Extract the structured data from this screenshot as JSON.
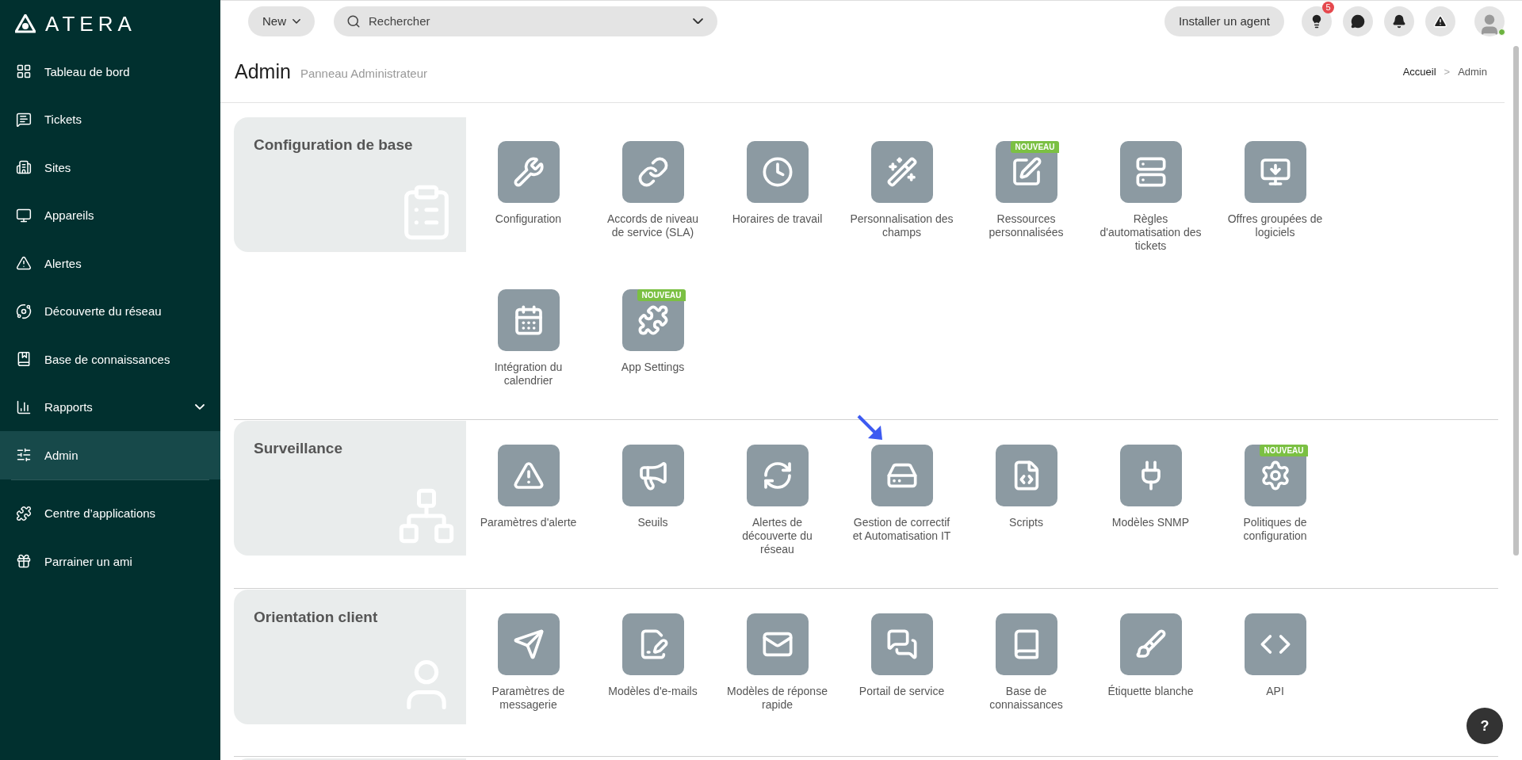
{
  "sidebar": {
    "logo": "ATERA",
    "items": [
      {
        "label": "Tableau de bord",
        "selected": false,
        "expandable": false
      },
      {
        "label": "Tickets",
        "selected": false,
        "expandable": false
      },
      {
        "label": "Sites",
        "selected": false,
        "expandable": false
      },
      {
        "label": "Appareils",
        "selected": false,
        "expandable": false
      },
      {
        "label": "Alertes",
        "selected": false,
        "expandable": false
      },
      {
        "label": "Découverte du réseau",
        "selected": false,
        "expandable": false
      },
      {
        "label": "Base de connaissances",
        "selected": false,
        "expandable": false
      },
      {
        "label": "Rapports",
        "selected": false,
        "expandable": true
      },
      {
        "label": "Admin",
        "selected": true,
        "expandable": false
      }
    ],
    "bottom_items": [
      {
        "label": "Centre d’applications"
      },
      {
        "label": "Parrainer un ami"
      }
    ]
  },
  "topbar": {
    "new_button": "New",
    "search": {
      "placeholder": "Rechercher"
    },
    "install_button": "Installer un agent",
    "notification_count": "5"
  },
  "header": {
    "title": "Admin",
    "subtitle": "Panneau Administrateur",
    "breadcrumb": [
      "Accueil",
      "Admin"
    ],
    "breadcrumb_separator": ">"
  },
  "sections": [
    {
      "title": "Configuration de base",
      "items": [
        {
          "label": "Configuration",
          "pointed": false
        },
        {
          "label": "Accords de niveau de service (SLA)",
          "pointed": false
        },
        {
          "label": "Horaires de travail",
          "pointed": false
        },
        {
          "label": "Personnalisation des champs",
          "pointed": false
        },
        {
          "label": "Ressources personnalisées",
          "badge": "NOUVEAU",
          "pointed": false
        },
        {
          "label": "Règles d'automatisation des tickets",
          "pointed": false
        },
        {
          "label": "Offres groupées de logiciels",
          "pointed": false
        },
        {
          "label": "Intégration du calendrier",
          "pointed": false
        },
        {
          "label": "App Settings",
          "badge": "NOUVEAU",
          "pointed": false
        }
      ]
    },
    {
      "title": "Surveillance",
      "items": [
        {
          "label": "Paramètres d'alerte",
          "pointed": false
        },
        {
          "label": "Seuils",
          "pointed": false
        },
        {
          "label": "Alertes de découverte du réseau",
          "pointed": false
        },
        {
          "label": "Gestion de correctif et Automatisation IT",
          "pointed": true
        },
        {
          "label": "Scripts",
          "pointed": false
        },
        {
          "label": "Modèles SNMP",
          "pointed": false
        },
        {
          "label": "Politiques de configuration",
          "badge": "NOUVEAU",
          "pointed": false
        }
      ]
    },
    {
      "title": "Orientation client",
      "items": [
        {
          "label": "Paramètres de messagerie",
          "pointed": false
        },
        {
          "label": "Modèles d'e-mails",
          "pointed": false
        },
        {
          "label": "Modèles de réponse rapide",
          "pointed": false
        },
        {
          "label": "Portail de service",
          "pointed": false
        },
        {
          "label": "Base de connaissances",
          "pointed": false
        },
        {
          "label": "Étiquette blanche",
          "pointed": false
        },
        {
          "label": "API",
          "pointed": false
        }
      ]
    }
  ],
  "help_button": "?"
}
